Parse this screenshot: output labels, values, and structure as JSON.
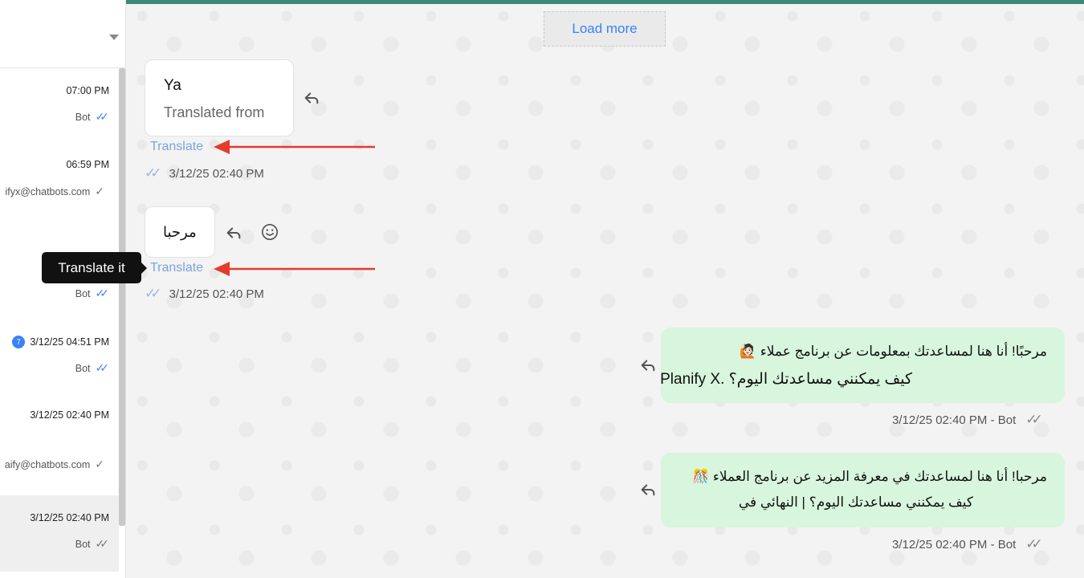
{
  "sidebar": {
    "items": [
      {
        "time": "07:00 PM",
        "sub": "Bot",
        "tick": "blue"
      },
      {
        "time": "06:59 PM",
        "sub": "ifyx@chatbots.com",
        "tick": "gray"
      },
      {
        "time": "",
        "sub": "Bot",
        "tick": "blue"
      },
      {
        "time": "3/12/25 04:51 PM",
        "badge": "7",
        "sub": "Bot",
        "tick": "blue"
      },
      {
        "time": "3/12/25 02:40 PM",
        "sub": "aify@chatbots.com",
        "tick": "gray"
      },
      {
        "time": "3/12/25 02:40 PM",
        "sub": "Bot",
        "tick": "gray"
      }
    ]
  },
  "chat": {
    "load_more": "Load more",
    "msg1": {
      "text": "Ya",
      "sub": "Translated from",
      "translate": "Translate",
      "timestamp": "3/12/25 02:40 PM"
    },
    "msg2": {
      "text": "مرحبا",
      "translate": "Translate",
      "timestamp": "3/12/25 02:40 PM"
    },
    "tooltip": "Translate it",
    "out1": {
      "line1": "مرحبًا! أنا هنا لمساعدتك بمعلومات عن برنامج عملاء 🙋🏻",
      "line2": "كيف يمكنني مساعدتك اليوم؟ .Planify X",
      "meta": "3/12/25 02:40 PM - Bot"
    },
    "out2": {
      "line1": "مرحبا! أنا هنا لمساعدتك في معرفة المزيد عن برنامج العملاء 🎊",
      "line2": "كيف يمكنني مساعدتك اليوم؟             | النهائي في",
      "meta": "3/12/25 02:40 PM - Bot"
    },
    "colors": {
      "accent": "#3b8a78",
      "link": "#3a82f7",
      "outgoing_bubble": "#d7f6dd",
      "arrow": "#e53b2c"
    }
  }
}
